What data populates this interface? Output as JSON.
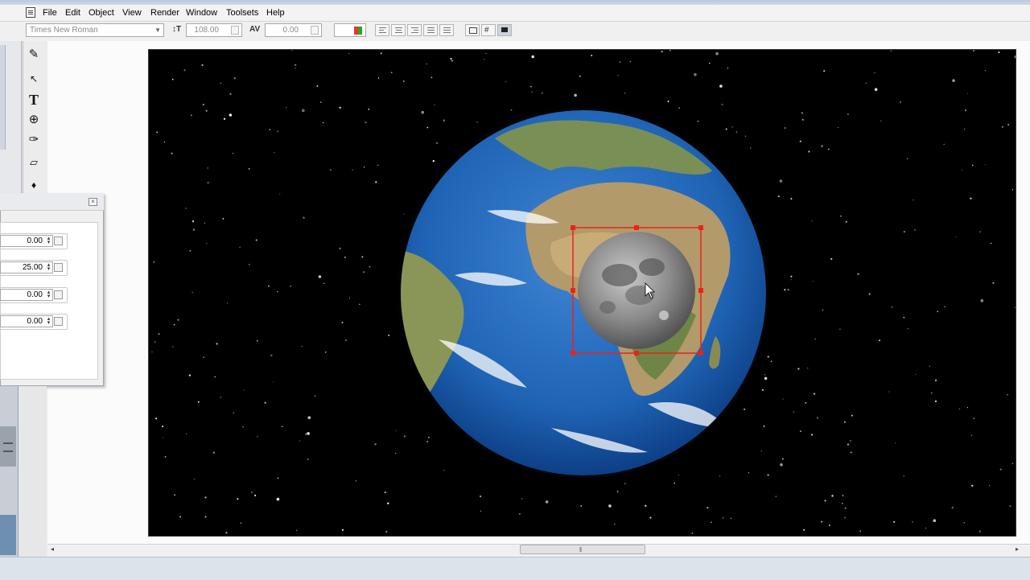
{
  "menubar": {
    "items": [
      "File",
      "Edit",
      "Object",
      "View",
      "Render",
      "Window",
      "Toolsets",
      "Help"
    ]
  },
  "toolbar": {
    "font_name": "Times New Roman",
    "size_icon": "font-size-icon",
    "size_label": "↕T",
    "font_size": "108.00",
    "tracking_label": "AV",
    "tracking": "0.00",
    "align_buttons": [
      "align-left",
      "align-center",
      "align-right",
      "align-justify",
      "align-force"
    ],
    "view_buttons": [
      "text-frame",
      "grid",
      "shadow"
    ]
  },
  "tools": [
    {
      "name": "selection-tool-icon",
      "glyph": "✎"
    },
    {
      "name": "arrow-tool-icon",
      "glyph": "↖"
    },
    {
      "name": "text-tool-icon",
      "glyph": "T"
    },
    {
      "name": "globe-tool-icon",
      "glyph": "⊕"
    },
    {
      "name": "freehand-tool-icon",
      "glyph": "✑"
    },
    {
      "name": "shape-tool-icon",
      "glyph": "▱"
    },
    {
      "name": "pen-tool-icon",
      "glyph": "♦"
    }
  ],
  "panel": {
    "fields": [
      "0.00",
      "25.00",
      "0.00",
      "0.00"
    ]
  },
  "colors": {
    "selection": "#e8231c",
    "ocean": "#1f63b4",
    "land": "#b39a6a",
    "moon": "#8a8a8a"
  }
}
